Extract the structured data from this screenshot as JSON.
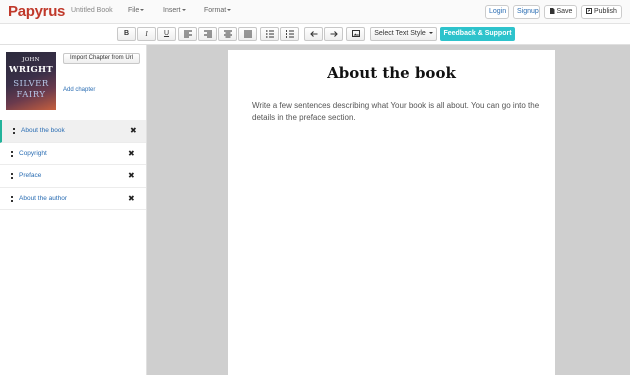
{
  "app": {
    "logo": "Papyrus",
    "book_title": "Untitled Book"
  },
  "menu": {
    "file": "File",
    "insert": "Insert",
    "format": "Format"
  },
  "account": {
    "login": "Login",
    "signup": "Signup",
    "save": "Save",
    "publish": "Publish"
  },
  "toolbar": {
    "bold": "B",
    "italic": "I",
    "underline": "U",
    "text_style": "Select Text Style",
    "feedback": "Feedback & Support"
  },
  "sidebar": {
    "cover": {
      "author_first": "JOHN",
      "author_last": "WRIGHT",
      "title_line1": "SILVER",
      "title_line2": "FAIRY"
    },
    "import_button": "Import Chapter from Url",
    "add_chapter": "Add chapter",
    "chapters": [
      {
        "label": "About the book",
        "active": true
      },
      {
        "label": "Copyright",
        "active": false
      },
      {
        "label": "Preface",
        "active": false
      },
      {
        "label": "About the author",
        "active": false
      }
    ]
  },
  "editor": {
    "title": "About the book",
    "body": "Write a few sentences describing what Your book is all about. You can go into the details in the preface section."
  },
  "colors": {
    "logo": "#c0392b",
    "link": "#2a6db3",
    "accent": "#2ec3cc",
    "active_marker": "#22b39b",
    "canvas": "#cfcfcf"
  }
}
